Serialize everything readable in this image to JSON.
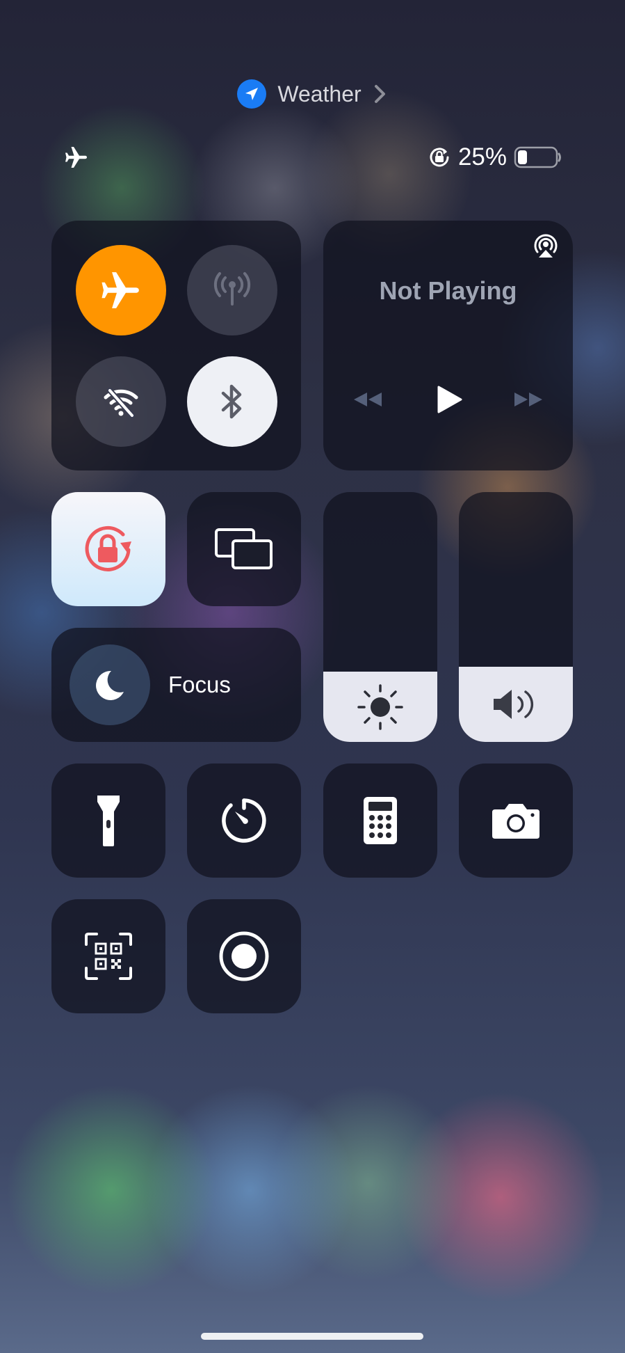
{
  "location_app": {
    "label": "Weather"
  },
  "status": {
    "battery_percent": "25%",
    "battery_level": 0.25
  },
  "media": {
    "status_text": "Not Playing"
  },
  "focus": {
    "label": "Focus"
  },
  "brightness": {
    "level": 0.28
  },
  "volume": {
    "level": 0.3
  },
  "connectivity": {
    "airplane_mode": true,
    "cellular_data": false,
    "wifi": false,
    "bluetooth": true
  },
  "toggles": {
    "orientation_lock": true,
    "screen_mirroring": false
  },
  "colors": {
    "accent_orange": "#ff9500",
    "location_blue": "#1a7cf5",
    "lock_red": "#ee5a5f"
  },
  "icons": [
    "airplane-icon",
    "cellular-icon",
    "wifi-off-icon",
    "bluetooth-icon",
    "airplay-icon",
    "rewind-icon",
    "play-icon",
    "fast-forward-icon",
    "orientation-lock-icon",
    "screen-mirroring-icon",
    "moon-icon",
    "sun-icon",
    "speaker-icon",
    "flashlight-icon",
    "timer-icon",
    "calculator-icon",
    "camera-icon",
    "qr-code-icon",
    "screen-record-icon"
  ]
}
